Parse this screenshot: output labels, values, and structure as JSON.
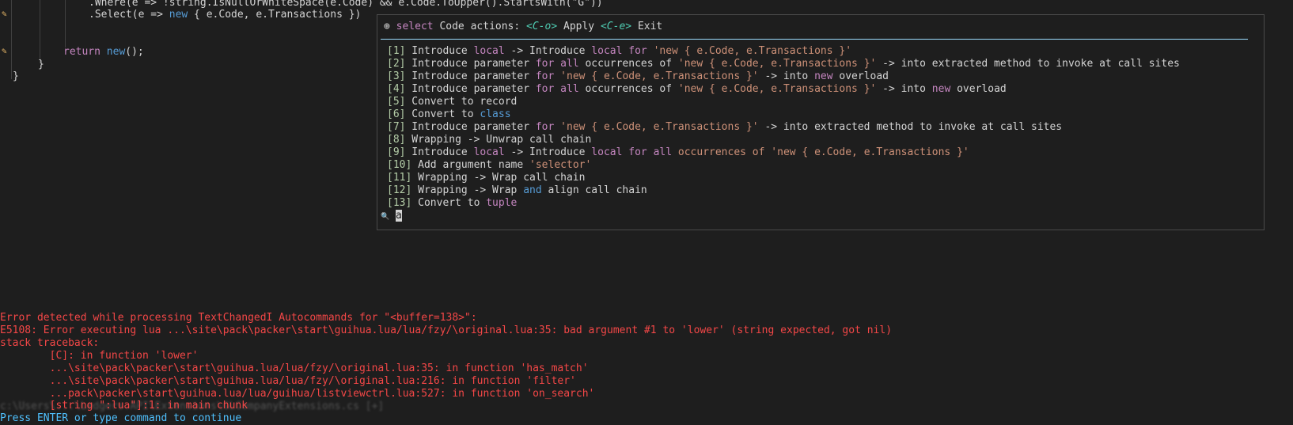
{
  "editor": {
    "line1_text": ".Where(e => !string.IsNullOrWhiteSpace(e.Code) && e.Code.ToUpper().StartsWith(\"G\"))",
    "line2_method": ".Select(e => ",
    "line2_kw": "new",
    "line2_rest": " { e.Code, e.Transactions })",
    "return_kw": "return",
    "return_new": "new",
    "return_rest": "();",
    "brace1": "}",
    "brace2": "}"
  },
  "code_actions": {
    "title_icon": "⊕",
    "title_select": "select",
    "title_label": "Code actions:",
    "apply_key": "<C-o>",
    "apply_label": "Apply",
    "exit_key": "<C-e>",
    "exit_label": "Exit",
    "items": [
      {
        "num": "[1]",
        "a": " Introduce ",
        "b": "local",
        "c": " -> Introduce ",
        "d": "local",
        "e": " ",
        "f": "for",
        "g": " ",
        "h": "'new { e.Code, e.Transactions }'",
        "i": ""
      },
      {
        "num": "[2]",
        "a": " Introduce parameter ",
        "b": "for",
        "c": " ",
        "d": "all",
        "e": " occurrences of ",
        "f": "'new { e.Code, e.Transactions }'",
        "g": " -> into extracted method to invoke at call sites",
        "h": "",
        "i": ""
      },
      {
        "num": "[3]",
        "a": " Introduce parameter ",
        "b": "for",
        "c": " ",
        "d": "'new { e.Code, e.Transactions }'",
        "e": " -> into ",
        "f": "new",
        "g": " overload",
        "h": "",
        "i": ""
      },
      {
        "num": "[4]",
        "a": " Introduce parameter ",
        "b": "for",
        "c": " ",
        "d": "all",
        "e": " occurrences of ",
        "f": "'new { e.Code, e.Transactions }'",
        "g": " -> into ",
        "h": "new",
        "i": " overload"
      },
      {
        "num": "[5]",
        "a": " Convert to record",
        "b": "",
        "c": "",
        "d": "",
        "e": "",
        "f": "",
        "g": "",
        "h": "",
        "i": ""
      },
      {
        "num": "[6]",
        "a": " Convert to ",
        "b": "class",
        "c": "",
        "d": "",
        "e": "",
        "f": "",
        "g": "",
        "h": "",
        "i": ""
      },
      {
        "num": "[7]",
        "a": " Introduce parameter ",
        "b": "for",
        "c": " ",
        "d": "'new { e.Code, e.Transactions }'",
        "e": " -> into extracted method to invoke at call sites",
        "f": "",
        "g": "",
        "h": "",
        "i": ""
      },
      {
        "num": "[8]",
        "a": " Wrapping -> Unwrap call chain",
        "b": "",
        "c": "",
        "d": "",
        "e": "",
        "f": "",
        "g": "",
        "h": "",
        "i": ""
      },
      {
        "num": "[9]",
        "a": " Introduce ",
        "b": "local",
        "c": " -> Introduce ",
        "d": "local",
        "e": " ",
        "f": "for",
        "g": " ",
        "h": "all",
        "i": " occurrences of 'new { e.Code, e.Transactions }'"
      },
      {
        "num": "[10]",
        "a": " Add argument name ",
        "b": "'selector'",
        "c": "",
        "d": "",
        "e": "",
        "f": "",
        "g": "",
        "h": "",
        "i": ""
      },
      {
        "num": "[11]",
        "a": " Wrapping -> Wrap call chain",
        "b": "",
        "c": "",
        "d": "",
        "e": "",
        "f": "",
        "g": "",
        "h": "",
        "i": ""
      },
      {
        "num": "[12]",
        "a": " Wrapping -> Wrap ",
        "b": "and",
        "c": " align call chain",
        "d": "",
        "e": "",
        "f": "",
        "g": "",
        "h": "",
        "i": ""
      },
      {
        "num": "[13]",
        "a": " Convert to ",
        "b": "tuple",
        "c": "",
        "d": "",
        "e": "",
        "f": "",
        "g": "",
        "h": "",
        "i": ""
      }
    ],
    "search_icon": "🔍",
    "search_value": "a"
  },
  "errors": {
    "lines": [
      "Error detected while processing TextChangedI Autocommands for \"<buffer=138>\":",
      "E5108: Error executing lua ...\\site\\pack\\packer\\start\\guihua.lua/lua/fzy/\\original.lua:35: bad argument #1 to 'lower' (string expected, got nil)",
      "stack traceback:",
      "        [C]: in function 'lower'",
      "        ...\\site\\pack\\packer\\start\\guihua.lua/lua/fzy/\\original.lua:35: in function 'has_match'",
      "        ...\\site\\pack\\packer\\start\\guihua.lua/lua/fzy/\\original.lua:216: in function 'filter'",
      "        ...pack\\packer\\start\\guihua.lua/lua/guihua/listviewctrl.lua:527: in function 'on_search'",
      "        [string \":lua\"]:1: in main chunk"
    ]
  },
  "statusline": "c:\\Users\\...\\Ledgers.API\\Extensions\\GLCompanyExtensions.cs [+]",
  "prompt": "Press ENTER or type command to continue"
}
